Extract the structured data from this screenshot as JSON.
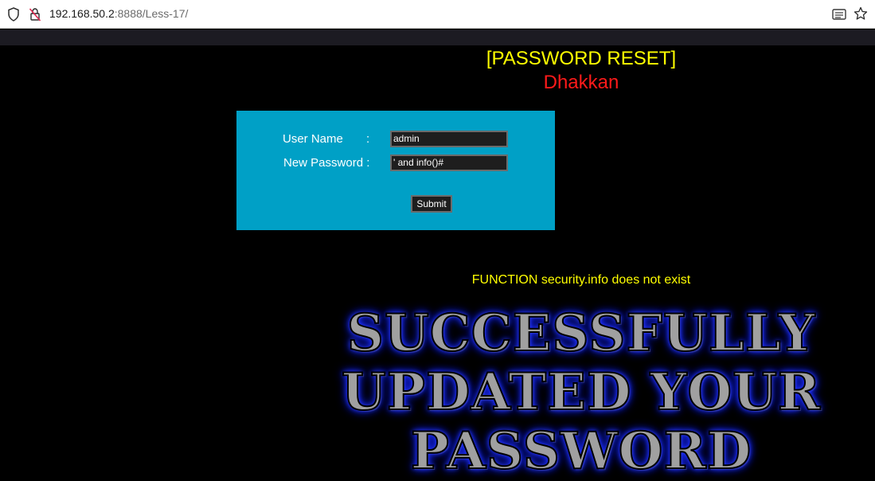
{
  "browser": {
    "url_host": "192.168.50.2",
    "url_rest": ":8888/Less-17/",
    "shield_icon": "shield-icon",
    "lock_icon": "lock-slash-icon",
    "reader_icon": "reader-view-icon",
    "bookmark_icon": "star-icon"
  },
  "page": {
    "title": "[PASSWORD RESET]",
    "subtitle": "Dhakkan",
    "colors": {
      "title": "#ffff00",
      "subtitle": "#ff1a1a",
      "form_bg": "#00a0c6",
      "message": "#ffff00"
    }
  },
  "form": {
    "username_label": "User Name",
    "username_colon": ":",
    "username_value": "admin",
    "password_label": "New Password :",
    "password_value": "' and info()#",
    "submit_label": "Submit"
  },
  "result": {
    "message": "FUNCTION security.info does not exist",
    "banner_line1": "SUCCESSFULLY",
    "banner_line2": "UPDATED YOUR",
    "banner_line3": "PASSWORD"
  }
}
